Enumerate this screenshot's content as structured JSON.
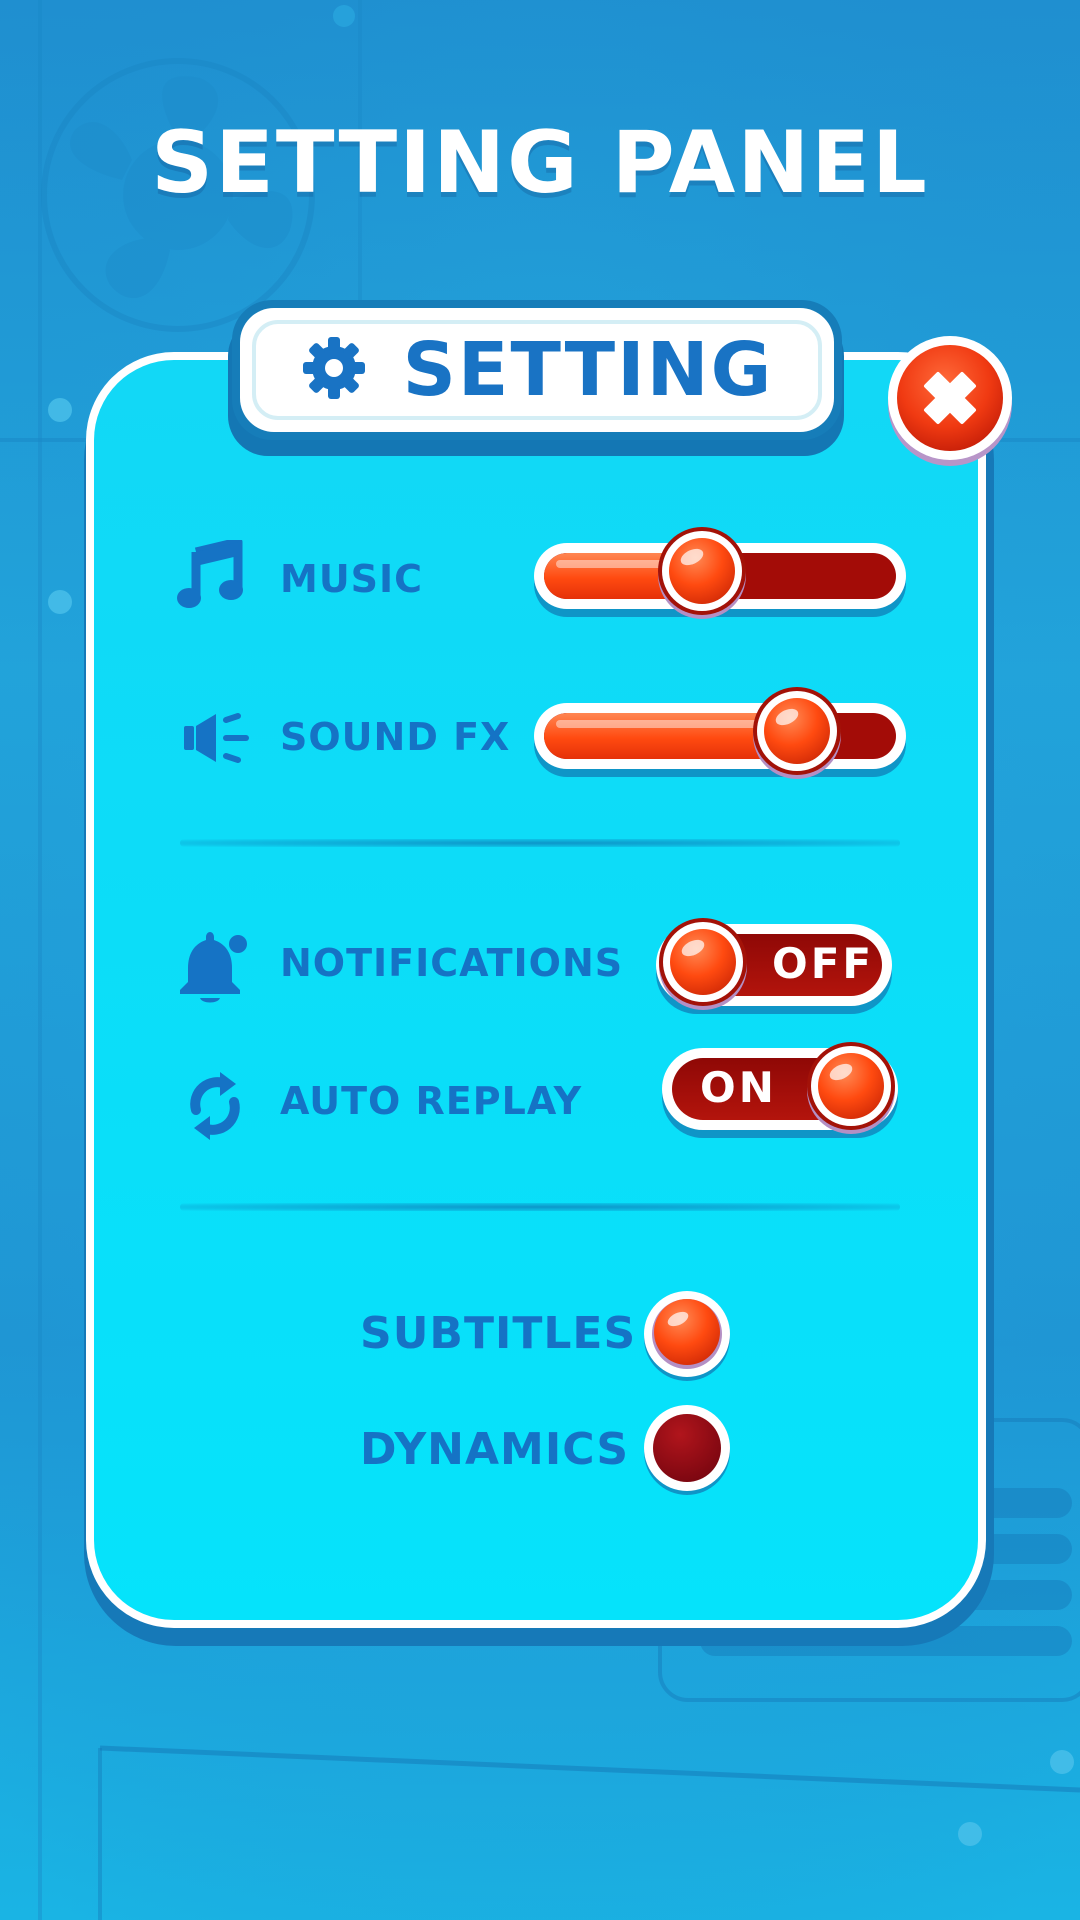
{
  "page": {
    "title": "SETTING PANEL"
  },
  "panel": {
    "title": "SETTING",
    "header_icon": "gear-icon",
    "close_icon": "close-icon"
  },
  "audio": {
    "music": {
      "label": "MUSIC",
      "icon": "music-note-icon",
      "level": 0.45
    },
    "sound_fx": {
      "label": "SOUND FX",
      "icon": "speaker-icon",
      "level": 0.72
    }
  },
  "toggles": {
    "notifications": {
      "label": "NOTIFICATIONS",
      "icon": "bell-icon",
      "state": "OFF"
    },
    "auto_replay": {
      "label": "AUTO REPLAY",
      "icon": "replay-icon",
      "state": "ON"
    }
  },
  "options": {
    "subtitles": {
      "label": "SUBTITLES",
      "selected": true
    },
    "dynamics": {
      "label": "DYNAMICS",
      "selected": false
    }
  },
  "colors": {
    "background": "#1f97d5",
    "panel": "#05e3fb",
    "accent_text": "#1573c5",
    "active_red": "#ff4a10",
    "inactive_red": "#a30c07"
  }
}
